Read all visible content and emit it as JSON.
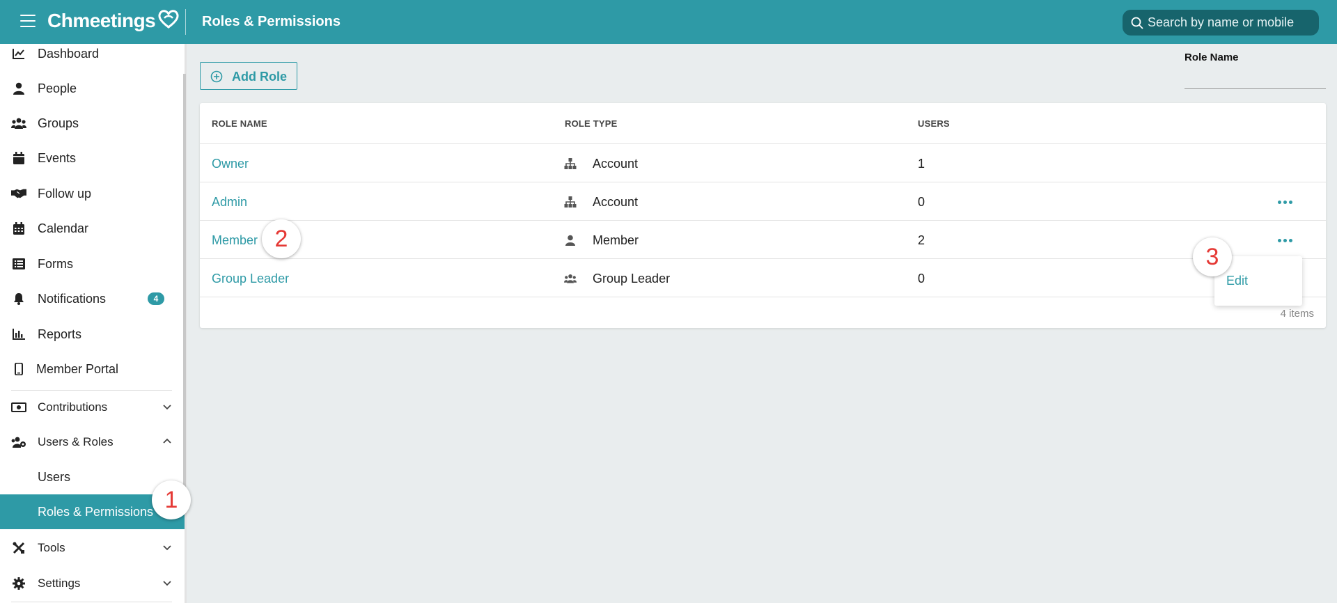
{
  "header": {
    "logo": "Chmeetings",
    "title": "Roles & Permissions",
    "search_placeholder": "Search by name or mobile"
  },
  "sidebar": {
    "items": [
      {
        "label": "Dashboard",
        "icon": "chart-line-icon"
      },
      {
        "label": "People",
        "icon": "person-icon"
      },
      {
        "label": "Groups",
        "icon": "users-icon"
      },
      {
        "label": "Events",
        "icon": "calendar-icon"
      },
      {
        "label": "Follow up",
        "icon": "handshake-icon"
      },
      {
        "label": "Calendar",
        "icon": "calendar-grid-icon"
      },
      {
        "label": "Forms",
        "icon": "list-icon"
      },
      {
        "label": "Notifications",
        "icon": "bell-icon",
        "badge": "4"
      },
      {
        "label": "Reports",
        "icon": "bar-chart-icon"
      },
      {
        "label": "Member Portal",
        "icon": "mobile-icon"
      },
      {
        "label": "Contributions",
        "icon": "money-icon"
      },
      {
        "label": "Users & Roles",
        "icon": "users-cog-icon"
      },
      {
        "label": "Users"
      },
      {
        "label": "Roles & Permissions"
      },
      {
        "label": "Tools",
        "icon": "tools-icon"
      },
      {
        "label": "Settings",
        "icon": "gear-icon"
      }
    ]
  },
  "main": {
    "add_role_label": "Add Role",
    "filter_label": "Role Name",
    "columns": [
      "ROLE NAME",
      "ROLE TYPE",
      "USERS"
    ],
    "rows": [
      {
        "name": "Owner",
        "type": "Account",
        "type_icon": "sitemap-icon",
        "users": "1"
      },
      {
        "name": "Admin",
        "type": "Account",
        "type_icon": "sitemap-icon",
        "users": "0"
      },
      {
        "name": "Member",
        "type": "Member",
        "type_icon": "person-icon",
        "users": "2"
      },
      {
        "name": "Group Leader",
        "type": "Group Leader",
        "type_icon": "users-icon",
        "users": "0"
      }
    ],
    "item_count": "4 items",
    "dropdown": {
      "edit_label": "Edit"
    }
  },
  "markers": [
    "1",
    "2",
    "3"
  ],
  "colors": {
    "accent": "#2e9aa6",
    "search_bg": "#17646c",
    "marker": "#e53935"
  }
}
